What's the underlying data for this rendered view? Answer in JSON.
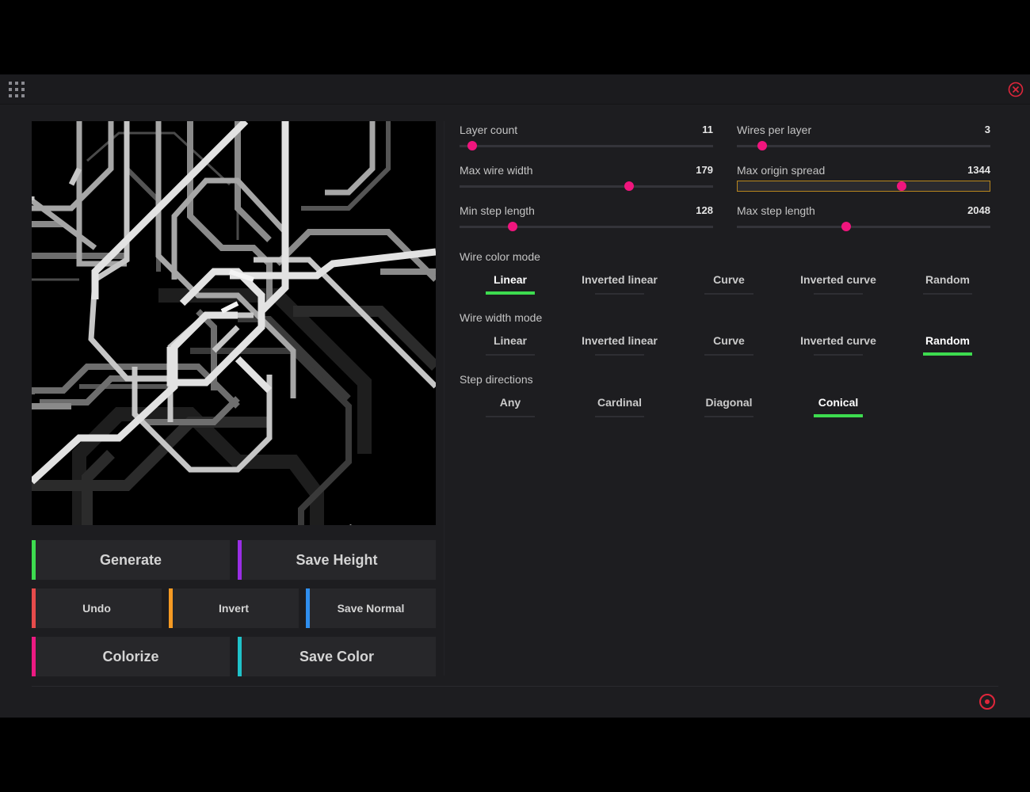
{
  "icons": {
    "menu": "grid-icon",
    "close": "close-icon",
    "cursor": "hand-cursor-icon",
    "target": "target-icon"
  },
  "colors": {
    "accent_knob": "#f0157d",
    "active_underline": "#3ddc4f",
    "focus_border": "#b8861e",
    "close_red": "#e0263b"
  },
  "sliders": [
    {
      "label": "Layer count",
      "value": "11",
      "fraction": 0.05
    },
    {
      "label": "Wires per layer",
      "value": "3",
      "fraction": 0.1
    },
    {
      "label": "Max wire width",
      "value": "179",
      "fraction": 0.67
    },
    {
      "label": "Max origin spread",
      "value": "1344",
      "fraction": 0.65,
      "focused": true
    },
    {
      "label": "Min step length",
      "value": "128",
      "fraction": 0.21
    },
    {
      "label": "Max step length",
      "value": "2048",
      "fraction": 0.43
    }
  ],
  "modes": [
    {
      "label": "Wire color mode",
      "options": [
        "Linear",
        "Inverted linear",
        "Curve",
        "Inverted curve",
        "Random"
      ],
      "selected": "Linear"
    },
    {
      "label": "Wire width mode",
      "options": [
        "Linear",
        "Inverted linear",
        "Curve",
        "Inverted curve",
        "Random"
      ],
      "selected": "Random"
    },
    {
      "label": "Step directions",
      "options": [
        "Any",
        "Cardinal",
        "Diagonal",
        "Conical"
      ],
      "selected": "Conical"
    }
  ],
  "buttons": {
    "generate": {
      "label": "Generate",
      "color": "#3ddc4f"
    },
    "save_height": {
      "label": "Save Height",
      "color": "#9a2ee6"
    },
    "undo": {
      "label": "Undo",
      "color": "#e64b4b"
    },
    "invert": {
      "label": "Invert",
      "color": "#f59a23"
    },
    "save_normal": {
      "label": "Save Normal",
      "color": "#2f8ff0"
    },
    "colorize": {
      "label": "Colorize",
      "color": "#ec1a82"
    },
    "save_color": {
      "label": "Save Color",
      "color": "#1fc2c9"
    }
  }
}
